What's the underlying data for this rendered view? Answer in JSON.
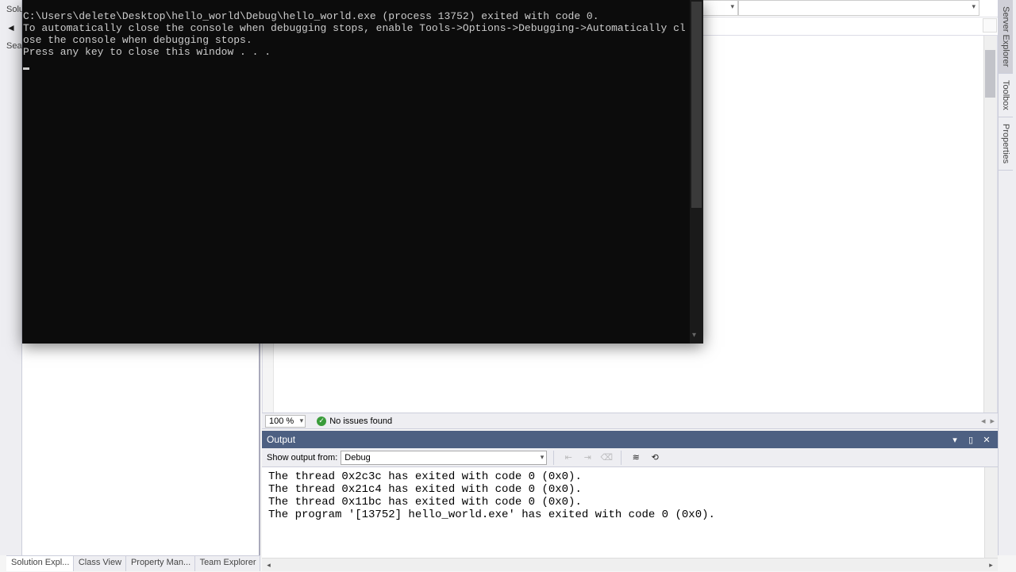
{
  "left": {
    "label": "Solu",
    "search_hint": "Sea"
  },
  "bottom_tabs": {
    "items": [
      {
        "label": "Solution Expl..."
      },
      {
        "label": "Class View"
      },
      {
        "label": "Property Man..."
      },
      {
        "label": "Team Explorer"
      }
    ]
  },
  "right_tools": {
    "items": [
      {
        "label": "Server Explorer"
      },
      {
        "label": "Toolbox"
      },
      {
        "label": "Properties"
      }
    ]
  },
  "editor": {
    "zoom": "100 %",
    "status_text": "No issues found"
  },
  "output": {
    "title": "Output",
    "show_label": "Show output from:",
    "source": "Debug",
    "lines": [
      "The thread 0x2c3c has exited with code 0 (0x0).",
      "The thread 0x21c4 has exited with code 0 (0x0).",
      "The thread 0x11bc has exited with code 0 (0x0).",
      "The program '[13752] hello_world.exe' has exited with code 0 (0x0)."
    ]
  },
  "console": {
    "line1": "C:\\Users\\delete\\Desktop\\hello_world\\Debug\\hello_world.exe (process 13752) exited with code 0.",
    "line2": "To automatically close the console when debugging stops, enable Tools->Options->Debugging->Automatically close the console when debugging stops.",
    "line3": "Press any key to close this window . . ."
  }
}
